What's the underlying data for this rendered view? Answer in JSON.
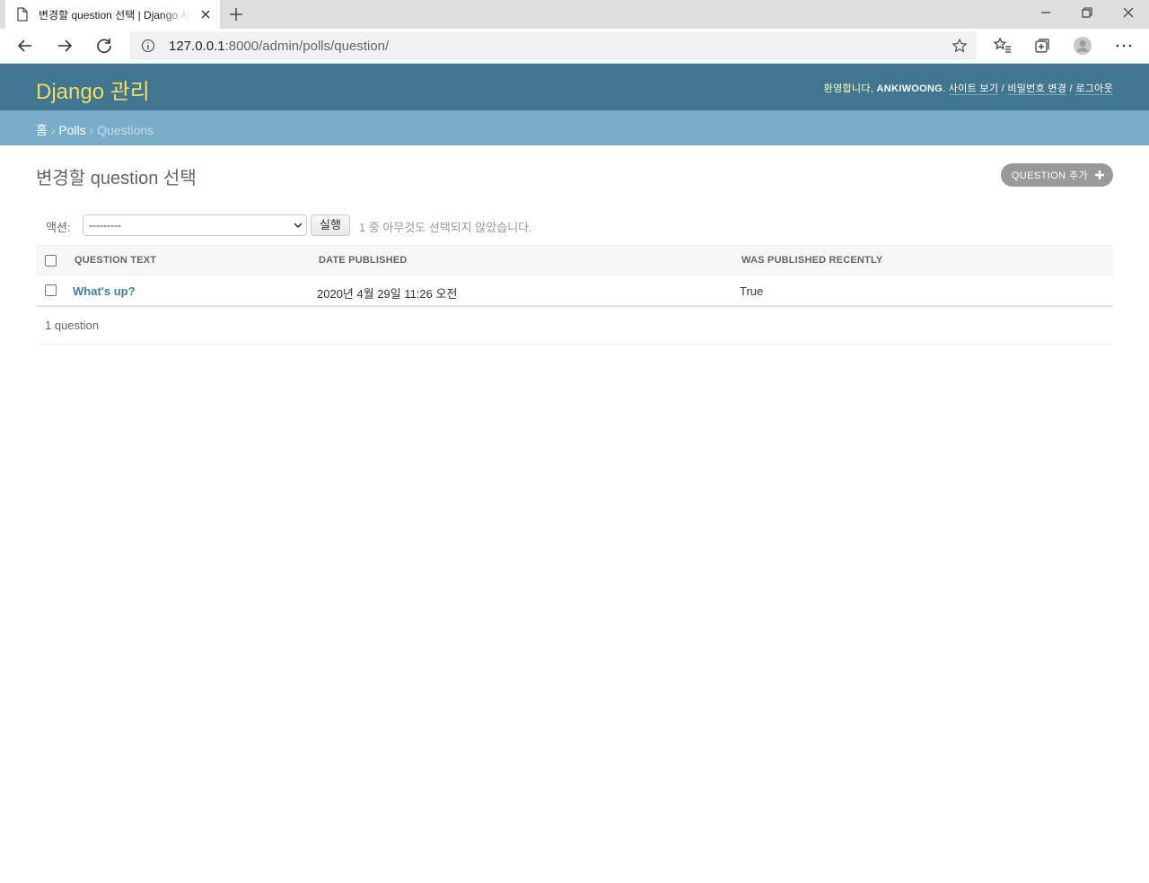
{
  "browser": {
    "tab_title": "변경할 question 선택 | Django 사이트 관리",
    "url_host": "127.0.0.1",
    "url_rest": ":8000/admin/polls/question/"
  },
  "header": {
    "branding": "Django 관리",
    "welcome": "환영합니다,",
    "username": "ANKIWOONG",
    "view_site": "사이트 보기",
    "change_password": "비밀번호 변경",
    "logout": "로그아웃"
  },
  "breadcrumbs": {
    "home": "홈",
    "app": "Polls",
    "model": "Questions"
  },
  "page": {
    "title": "변경할 question 선택",
    "add_button": "QUESTION 추가"
  },
  "actions": {
    "label": "액션:",
    "selected_option": "---------",
    "go": "실행",
    "counter": "1 중 아무것도 선택되지 않았습니다."
  },
  "table": {
    "columns": [
      "QUESTION TEXT",
      "DATE PUBLISHED",
      "WAS PUBLISHED RECENTLY"
    ],
    "rows": [
      {
        "question_text": "What's up?",
        "date_published": "2020년 4월 29일 11:26 오전",
        "was_published_recently": "True"
      }
    ]
  },
  "paginator": "1 question",
  "colors": {
    "header": "#417690",
    "breadcrumbs": "#79aec8",
    "branding": "#f5dd5d",
    "link": "#447e9b"
  }
}
